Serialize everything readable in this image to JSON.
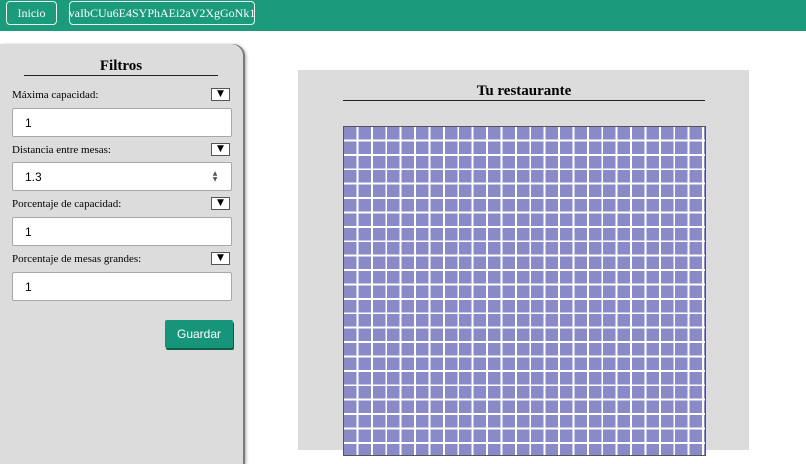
{
  "colors": {
    "topbar": "#1b9a7c",
    "accent_button": "#17957a",
    "table_cell": "#8a8ac8",
    "panel": "#dcdcdc"
  },
  "nav": {
    "home_label": "Inicio",
    "token_label": "vaIbCUu6E4SYPhAEi2aV2XgGoNk1"
  },
  "filters": {
    "title": "Filtros",
    "fields": [
      {
        "label": "Máxima capacidad:",
        "value": "1"
      },
      {
        "label": "Distancia entre mesas:",
        "value": "1.3"
      },
      {
        "label": "Porcentaje de capacidad:",
        "value": "1"
      },
      {
        "label": "Porcentaje de mesas grandes:",
        "value": "1"
      }
    ],
    "dropdown_icon": "▼",
    "save_label": "Guardar"
  },
  "restaurant": {
    "title": "Tu restaurante"
  }
}
